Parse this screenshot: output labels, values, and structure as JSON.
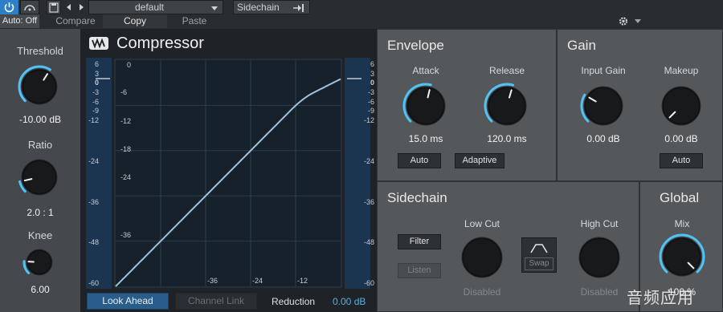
{
  "toolbar": {
    "auto_off": "Auto: Off",
    "preset": "default",
    "compare": "Compare",
    "copy": "Copy",
    "paste": "Paste",
    "sidechain": "Sidechain"
  },
  "plugin": {
    "title": "Compressor"
  },
  "left": {
    "threshold": {
      "label": "Threshold",
      "value": "-10.00 dB",
      "level": 0.62
    },
    "ratio": {
      "label": "Ratio",
      "value": "2.0 : 1",
      "level": 0.12
    },
    "knee": {
      "label": "Knee",
      "value": "6.00",
      "level": 0.18
    }
  },
  "graph": {
    "left_scale": [
      "6",
      "3",
      "0",
      "-3",
      "-6",
      "-9",
      "-12",
      "-24",
      "-36",
      "-48",
      "-60"
    ],
    "right_scale": [
      "6",
      "3",
      "0",
      "-3",
      "-6",
      "-9",
      "-12",
      "-24",
      "-36",
      "-48",
      "-60"
    ],
    "y_labels": [
      "0",
      "-6",
      "-12",
      "-18",
      "-24",
      "-36"
    ],
    "x_labels": [
      "-36",
      "-24",
      "-12"
    ],
    "look_ahead": "Look Ahead",
    "channel_link": "Channel Link",
    "reduction_label": "Reduction",
    "reduction_value": "0.00 dB"
  },
  "envelope": {
    "title": "Envelope",
    "attack": {
      "label": "Attack",
      "value": "15.0 ms",
      "level": 0.55
    },
    "release": {
      "label": "Release",
      "value": "120.0 ms",
      "level": 0.56
    },
    "auto": "Auto",
    "adaptive": "Adaptive"
  },
  "gain": {
    "title": "Gain",
    "input_gain": {
      "label": "Input Gain",
      "value": "0.00 dB",
      "level": 0.28
    },
    "makeup": {
      "label": "Makeup",
      "value": "0.00 dB",
      "level": 0.0
    },
    "auto": "Auto"
  },
  "sidechain": {
    "title": "Sidechain",
    "filter": "Filter",
    "listen": "Listen",
    "low_cut": {
      "label": "Low Cut",
      "value": "Disabled",
      "level": 0.0
    },
    "high_cut": {
      "label": "High Cut",
      "value": "Disabled",
      "level": 1.0
    },
    "swap": "Swap"
  },
  "global": {
    "title": "Global",
    "mix": {
      "label": "Mix",
      "value": "100 %",
      "level": 1.0
    }
  },
  "watermark": "音频应用",
  "colors": {
    "accent": "#4fc3f7",
    "toolbar_blue": "#2d7fc7",
    "curve": "#9fc3dd"
  },
  "icons": [
    "power-icon",
    "save-icon",
    "back-arrow-icon",
    "forward-arrow-icon",
    "dropdown-arrow-icon",
    "sidechain-icon",
    "gear-icon",
    "logo-icon"
  ]
}
